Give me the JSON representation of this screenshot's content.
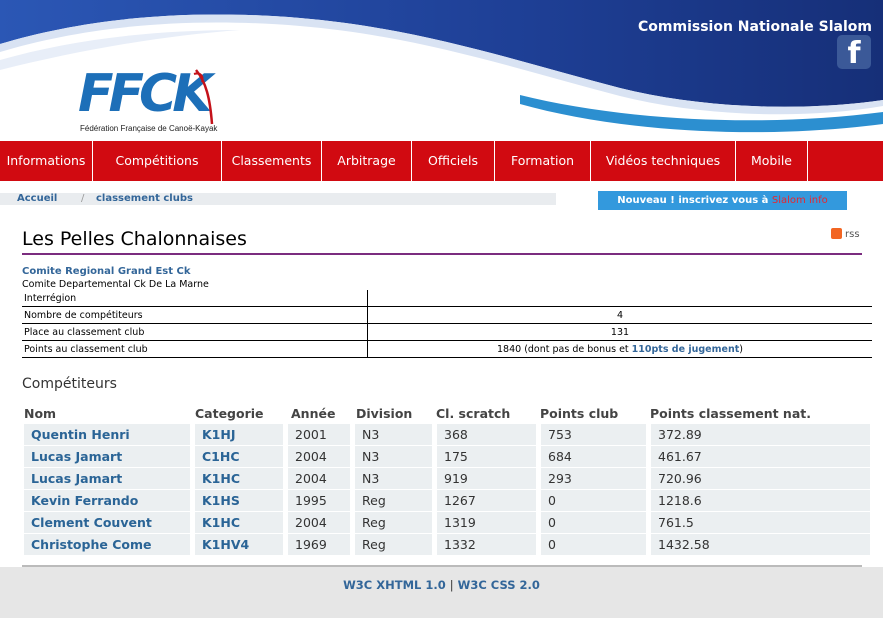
{
  "header": {
    "site_title": "Commission Nationale Slalom",
    "logo_text": "FFCK",
    "logo_subtitle": "Fédération Française de Canoë-Kayak",
    "facebook_glyph": "f"
  },
  "nav": {
    "items": [
      {
        "label": "Informations"
      },
      {
        "label": "Compétitions"
      },
      {
        "label": "Classements"
      },
      {
        "label": "Arbitrage"
      },
      {
        "label": "Officiels"
      },
      {
        "label": "Formation"
      },
      {
        "label": "Vidéos techniques"
      },
      {
        "label": "Mobile"
      }
    ]
  },
  "breadcrumb": {
    "home": "Accueil",
    "separator": "/",
    "current": "classement clubs"
  },
  "promo": {
    "text": "Nouveau ! inscrivez vous à",
    "highlight": "Slalom info"
  },
  "club": {
    "name": "Les Pelles Chalonnaises",
    "rss_label": "rss",
    "region": "Comite Regional Grand Est Ck",
    "department": "Comite Departemental Ck De La Marne"
  },
  "info_table": {
    "rows": [
      {
        "label": "Interrégion",
        "value": ""
      },
      {
        "label": "Nombre de compétiteurs",
        "value": "4"
      },
      {
        "label": "Place au classement club",
        "value": "131"
      },
      {
        "label": "Points au classement club",
        "value": "1840 (dont pas de bonus et ",
        "link": "110pts de jugement",
        "suffix": ")"
      }
    ]
  },
  "competitors": {
    "section_title": "Compétiteurs",
    "columns": [
      "Nom",
      "Categorie",
      "Année",
      "Division",
      "Cl. scratch",
      "Points club",
      "Points classement nat."
    ],
    "rows": [
      [
        "Quentin Henri",
        "K1HJ",
        "2001",
        "N3",
        "368",
        "753",
        "372.89"
      ],
      [
        "Lucas Jamart",
        "C1HC",
        "2004",
        "N3",
        "175",
        "684",
        "461.67"
      ],
      [
        "Lucas Jamart",
        "K1HC",
        "2004",
        "N3",
        "919",
        "293",
        "720.96"
      ],
      [
        "Kevin Ferrando",
        "K1HS",
        "1995",
        "Reg",
        "1267",
        "0",
        "1218.6"
      ],
      [
        "Clement Couvent",
        "K1HC",
        "2004",
        "Reg",
        "1319",
        "0",
        "761.5"
      ],
      [
        "Christophe Come",
        "K1HV4",
        "1969",
        "Reg",
        "1332",
        "0",
        "1432.58"
      ]
    ]
  },
  "footer": {
    "link1": "W3C XHTML 1.0",
    "separator": "|",
    "link2": "W3C CSS 2.0"
  },
  "colors": {
    "nav_red": "#d10a11",
    "wave_blue": "#1e3f95",
    "link_blue": "#336699",
    "title_rule": "#7b2c7f",
    "promo_blue": "#3399dd"
  }
}
